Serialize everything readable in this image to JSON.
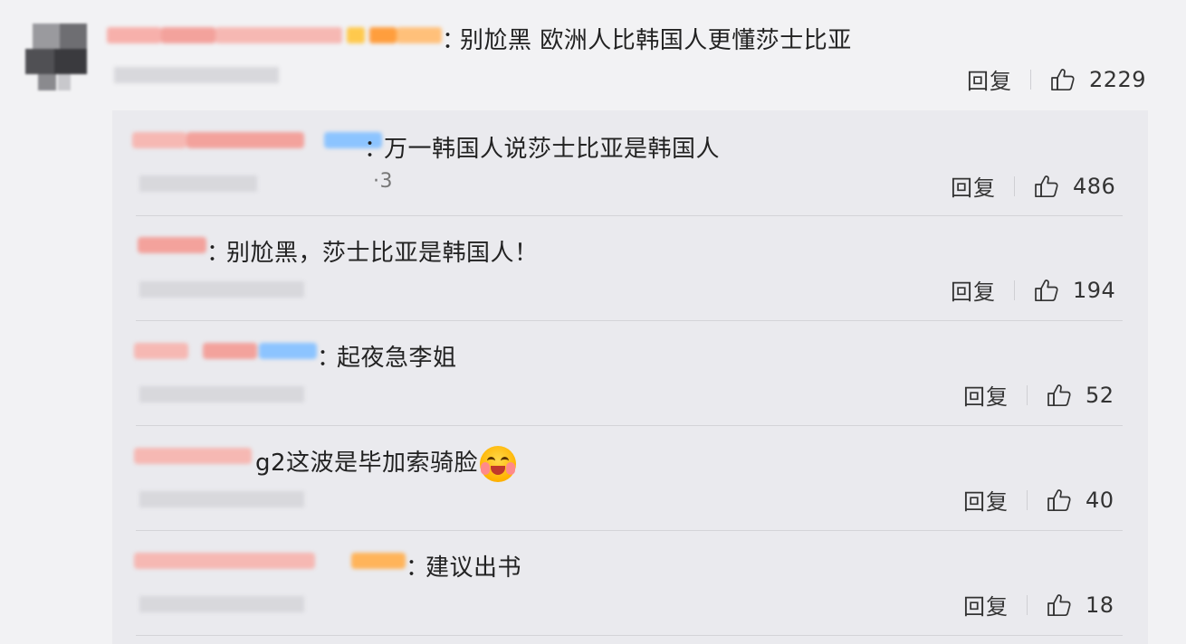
{
  "main_comment": {
    "text": "别尬黑 欧洲人比韩国人更懂莎士比亚",
    "colon": "：",
    "reply_label": "回复",
    "likes": "2229"
  },
  "replies": [
    {
      "text": "万一韩国人说莎士比亚是韩国人",
      "colon": "：",
      "meta": "·3",
      "reply_label": "回复",
      "likes": "486"
    },
    {
      "text": "别尬黑，莎士比亚是韩国人！",
      "colon": "：",
      "reply_label": "回复",
      "likes": "194"
    },
    {
      "text": "起夜急李姐",
      "colon": "：",
      "reply_label": "回复",
      "likes": "52"
    },
    {
      "text": "g2这波是毕加索骑脸",
      "reply_label": "回复",
      "likes": "40"
    },
    {
      "text": "建议出书",
      "colon": "：",
      "reply_label": "回复",
      "likes": "18"
    }
  ],
  "icons": {
    "like": "thumbs-up-icon",
    "emoji": "hugging-face-emoji-icon"
  },
  "colors": {
    "background": "#f2f2f4",
    "panel": "#eaeaee",
    "redacted_pink": "#f7a9a4",
    "redacted_orange": "#ffb45a",
    "redacted_blue": "#8cc4ff",
    "redacted_gray": "#d8d8dc"
  }
}
